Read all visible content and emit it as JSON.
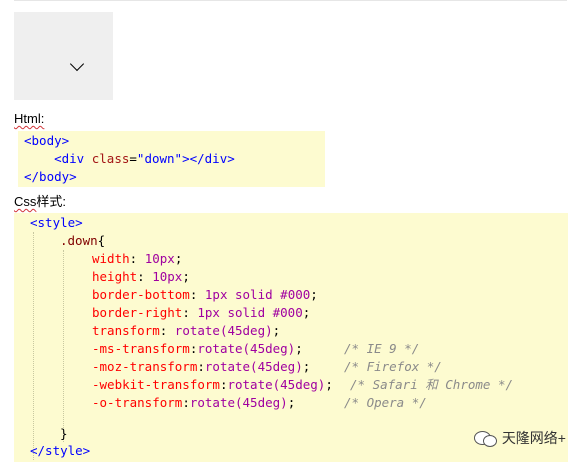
{
  "demo": {
    "icon": "chevron-down-icon"
  },
  "html_label": "Html:",
  "html_code": {
    "lines": [
      {
        "open": "<body>"
      },
      {
        "indent": "    ",
        "tag_open": "<div ",
        "attr": "class",
        "eq": "=",
        "value": "\"down\"",
        "tag_close": "></div>"
      },
      {
        "open": "</body>"
      }
    ]
  },
  "css_label": {
    "word": "Css",
    "rest": "样式:"
  },
  "css_code": {
    "style_open": "<style>",
    "selector": ".down",
    "brace_open": "{",
    "declarations": [
      {
        "prop": "width",
        "value": "10px",
        "rest": ";",
        "comment": ""
      },
      {
        "prop": "height",
        "value": "10px",
        "rest": ";",
        "comment": ""
      },
      {
        "prop": "border-bottom",
        "value": "1px solid #000",
        "rest": ";",
        "comment": ""
      },
      {
        "prop": "border-right",
        "value": "1px solid #000",
        "rest": ";",
        "comment": ""
      },
      {
        "prop": "transform",
        "value": "rotate(45deg)",
        "rest": ";",
        "comment": ""
      },
      {
        "prop": "-ms-transform",
        "value": "rotate(45deg)",
        "rest": ";",
        "comment": "/* IE 9 */"
      },
      {
        "prop": "-moz-transform",
        "value": "rotate(45deg)",
        "rest": ";",
        "comment": "/* Firefox */"
      },
      {
        "prop": "-webkit-transform",
        "value": "rotate(45deg)",
        "rest": ";",
        "comment": "/* Safari 和 Chrome */"
      },
      {
        "prop": "-o-transform",
        "value": "rotate(45deg)",
        "rest": ";",
        "comment": "/* Opera */"
      }
    ],
    "brace_close": "}",
    "style_close": "</style>"
  },
  "watermark": {
    "text": "天隆网络+",
    "icon": "wechat-icon"
  }
}
